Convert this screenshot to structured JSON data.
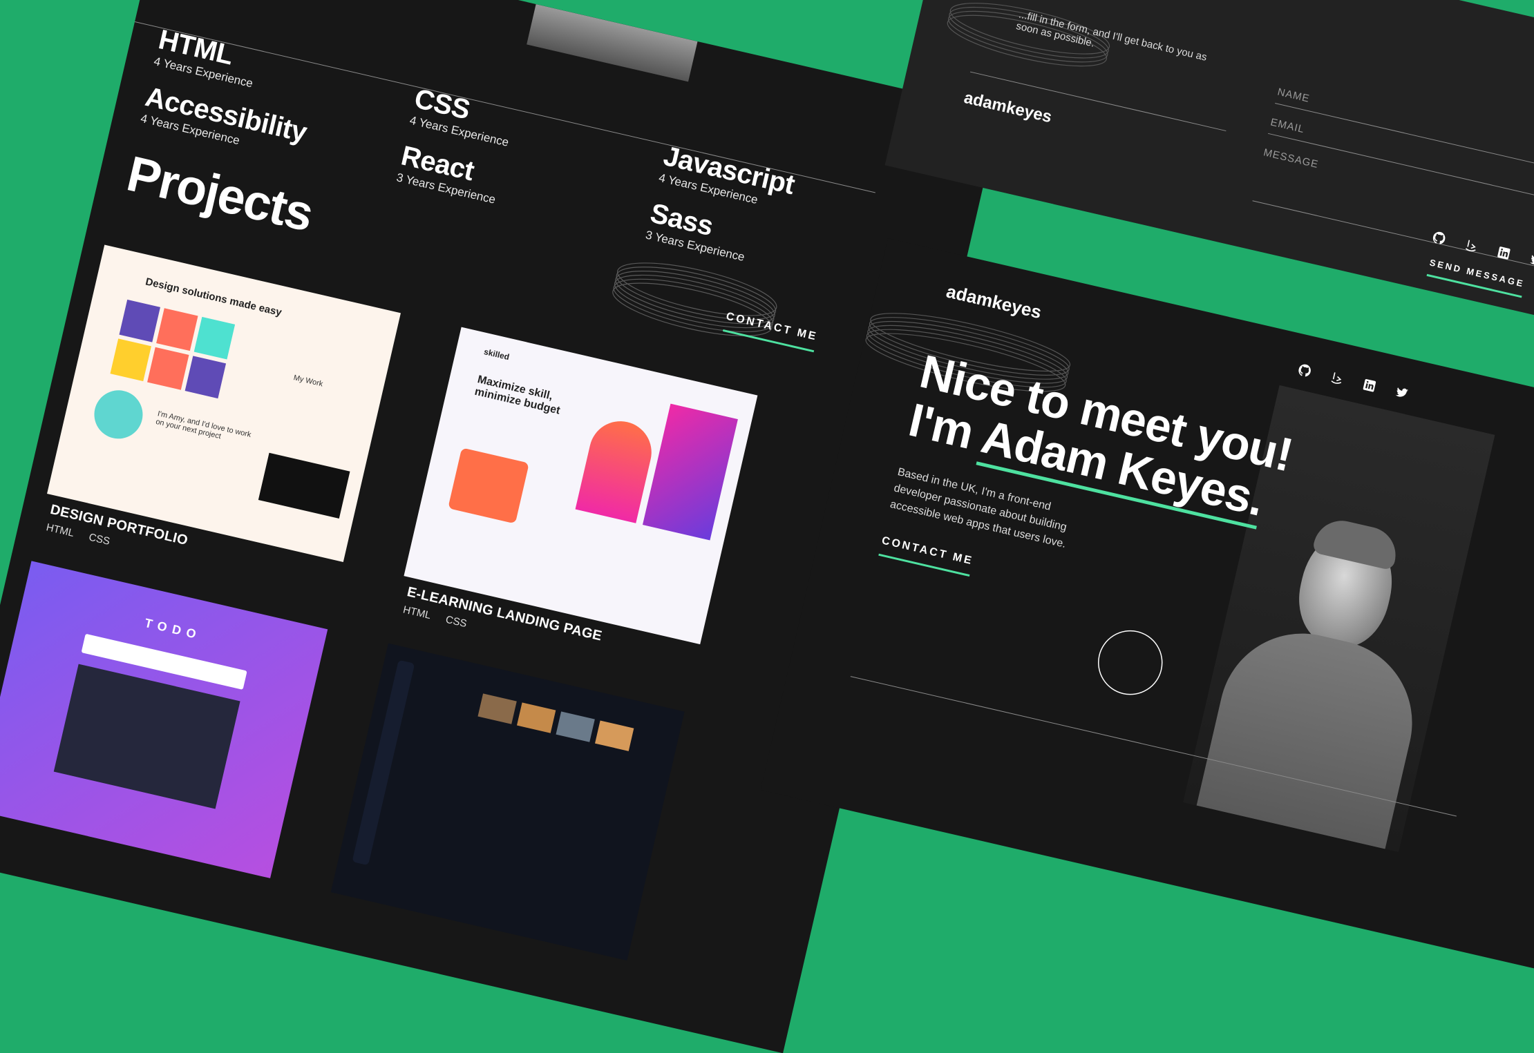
{
  "skills": [
    {
      "name": "HTML",
      "years": "4 Years Experience"
    },
    {
      "name": "CSS",
      "years": "4 Years Experience"
    },
    {
      "name": "Javascript",
      "years": "4 Years Experience"
    },
    {
      "name": "Accessibility",
      "years": "4 Years Experience"
    },
    {
      "name": "React",
      "years": "3 Years Experience"
    },
    {
      "name": "Sass",
      "years": "3 Years Experience"
    }
  ],
  "projects_heading": "Projects",
  "contact_cta": "CONTACT ME",
  "projects": [
    {
      "title": "DESIGN PORTFOLIO",
      "tags": [
        "HTML",
        "CSS"
      ]
    },
    {
      "title": "E-LEARNING LANDING PAGE",
      "tags": [
        "HTML",
        "CSS"
      ]
    }
  ],
  "mock_text": {
    "portfolio_heading": "Design solutions made easy",
    "portfolio_sub1": "I'm Amy, and I'd love to work on your next project",
    "portfolio_sub2": "I'm Amy, and I'd love to work on your next project",
    "portfolio_mywork": "My Work",
    "elearning_heading": "Maximize skill, minimize budget",
    "elearning_logo": "skilled",
    "todo_title": "TODO"
  },
  "contact": {
    "intro": "...fill in the form, and I'll get back to you as soon as possible.",
    "name_label": "NAME",
    "email_label": "EMAIL",
    "message_label": "MESSAGE",
    "send_label": "SEND MESSAGE"
  },
  "brand": "adamkeyes",
  "hero": {
    "line1": "Nice to meet you!",
    "line2_prefix": "I'm ",
    "line2_name": "Adam Keyes.",
    "bio": "Based in the UK, I'm a front-end developer passionate about building accessible web apps that users love.",
    "cta": "CONTACT ME"
  },
  "social_icons": [
    "github-icon",
    "frontend-mentor-icon",
    "linkedin-icon",
    "twitter-icon"
  ],
  "colors": {
    "accent": "#4ee1a0",
    "background": "#1fac6a",
    "panel": "#171717"
  }
}
